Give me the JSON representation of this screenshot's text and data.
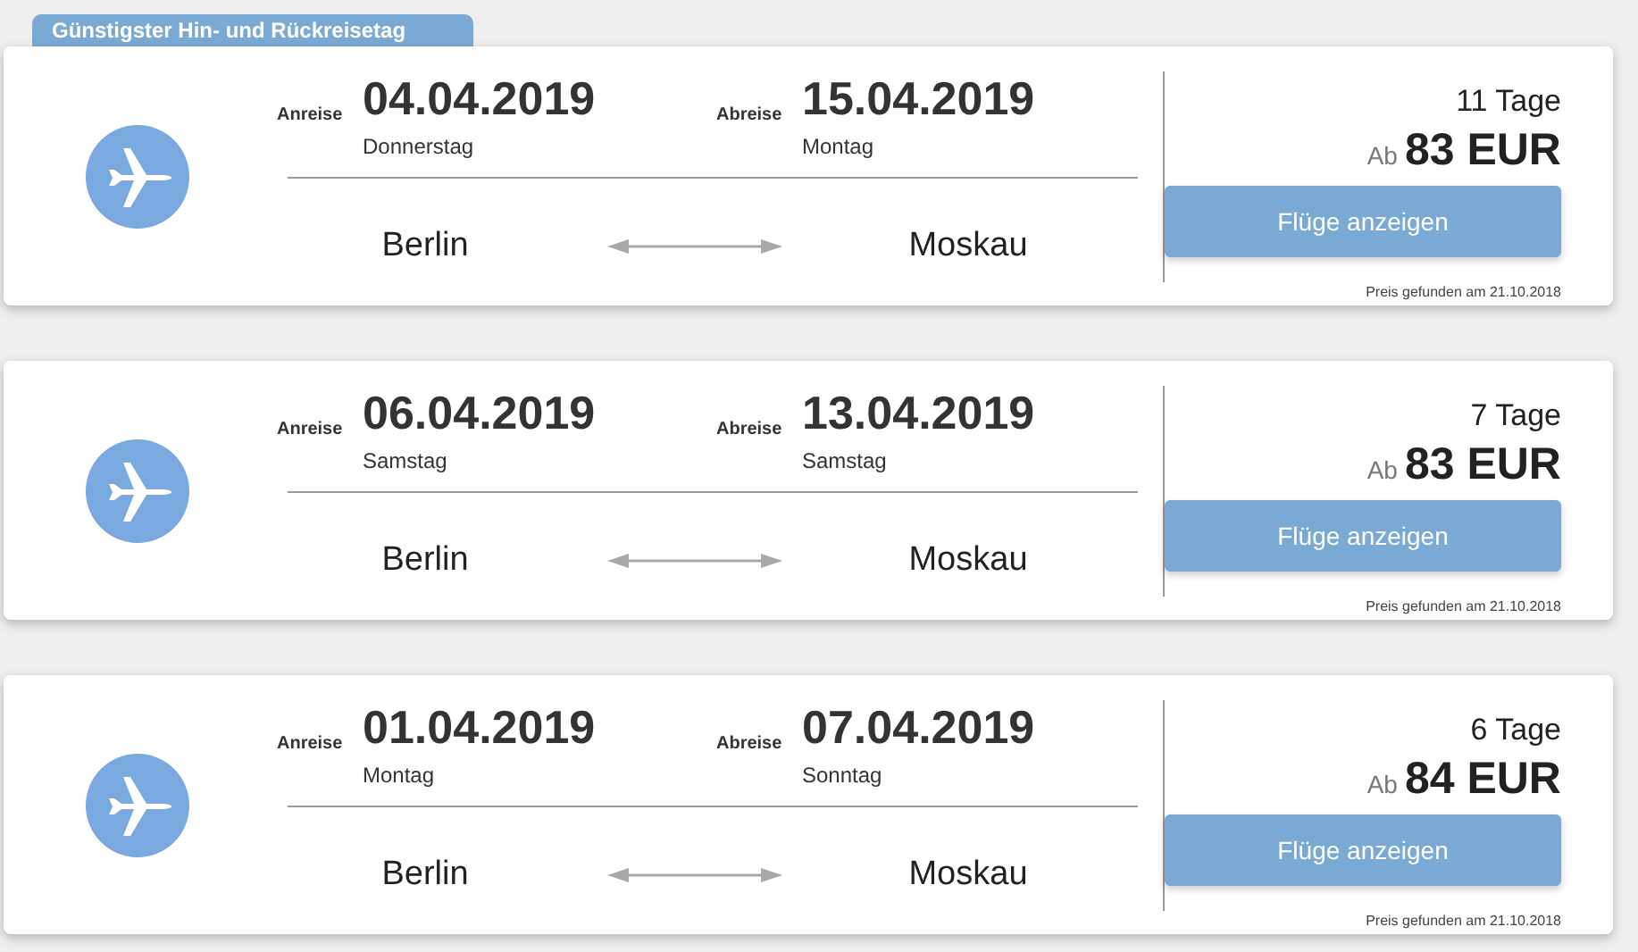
{
  "tab_label": "Günstigster Hin- und Rückreisetag",
  "offers": [
    {
      "outbound": {
        "label": "Anreise",
        "date": "04.04.2019",
        "weekday": "Donnerstag"
      },
      "return": {
        "label": "Abreise",
        "date": "15.04.2019",
        "weekday": "Montag"
      },
      "from": "Berlin",
      "to": "Moskau",
      "duration": "11 Tage",
      "price_prefix": "Ab",
      "price": "83 EUR",
      "button": "Flüge anzeigen",
      "found": "Preis gefunden am 21.10.2018"
    },
    {
      "outbound": {
        "label": "Anreise",
        "date": "06.04.2019",
        "weekday": "Samstag"
      },
      "return": {
        "label": "Abreise",
        "date": "13.04.2019",
        "weekday": "Samstag"
      },
      "from": "Berlin",
      "to": "Moskau",
      "duration": "7 Tage",
      "price_prefix": "Ab",
      "price": "83 EUR",
      "button": "Flüge anzeigen",
      "found": "Preis gefunden am 21.10.2018"
    },
    {
      "outbound": {
        "label": "Anreise",
        "date": "01.04.2019",
        "weekday": "Montag"
      },
      "return": {
        "label": "Abreise",
        "date": "07.04.2019",
        "weekday": "Sonntag"
      },
      "from": "Berlin",
      "to": "Moskau",
      "duration": "6 Tage",
      "price_prefix": "Ab",
      "price": "84 EUR",
      "button": "Flüge anzeigen",
      "found": "Preis gefunden am 21.10.2018"
    }
  ]
}
